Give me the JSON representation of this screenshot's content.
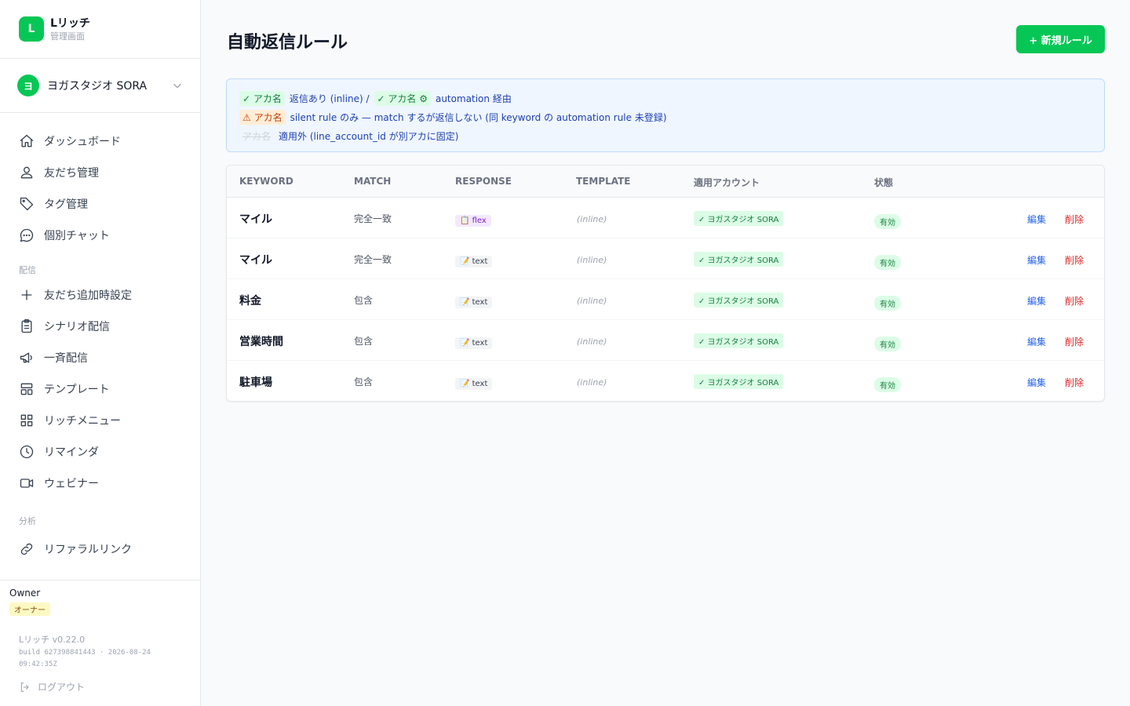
{
  "brand": {
    "logo_letter": "L",
    "name": "Lリッチ",
    "subtitle": "管理画面"
  },
  "account": {
    "avatar_letter": "ヨ",
    "name": "ヨガスタジオ SORA"
  },
  "nav": {
    "main": [
      {
        "label": "ダッシュボード",
        "icon": "home-icon"
      },
      {
        "label": "友だち管理",
        "icon": "users-icon"
      },
      {
        "label": "タグ管理",
        "icon": "tag-icon"
      },
      {
        "label": "個別チャット",
        "icon": "chat-icon"
      }
    ],
    "section_delivery": "配信",
    "delivery": [
      {
        "label": "友だち追加時設定",
        "icon": "plus-icon"
      },
      {
        "label": "シナリオ配信",
        "icon": "clipboard-icon"
      },
      {
        "label": "一斉配信",
        "icon": "megaphone-icon"
      },
      {
        "label": "テンプレート",
        "icon": "template-icon"
      },
      {
        "label": "リッチメニュー",
        "icon": "grid-icon"
      },
      {
        "label": "リマインダ",
        "icon": "clock-icon"
      },
      {
        "label": "ウェビナー",
        "icon": "video-icon"
      }
    ],
    "section_analytics": "分析",
    "analytics": [
      {
        "label": "リファラルリンク",
        "icon": "link-icon"
      }
    ]
  },
  "footer": {
    "owner_name": "Owner",
    "owner_badge": "オーナー",
    "version": "Lリッチ v0.22.0",
    "build": "build 627398841443 · 2026-08-24 09:42:35Z",
    "logout": "ログアウト"
  },
  "page": {
    "title": "自動返信ルール",
    "new_button": "+ 新規ルール"
  },
  "legend": {
    "line1": {
      "pill1": "✓ アカ名",
      "text1": "返信あり (inline) /",
      "pill2": "✓ アカ名 ⚙",
      "text2": "automation 経由"
    },
    "line2": {
      "pill": "⚠ アカ名",
      "text": "silent rule のみ — match するが返信しない (同 keyword の automation rule 未登録)"
    },
    "line3": {
      "pill": "アカ名",
      "text": "適用外 (line_account_id が別アカに固定)"
    }
  },
  "table": {
    "headers": {
      "keyword": "KEYWORD",
      "match": "MATCH",
      "response": "RESPONSE",
      "template": "TEMPLATE",
      "account": "適用アカウント",
      "status": "状態"
    },
    "rows": [
      {
        "keyword": "マイル",
        "match": "完全一致",
        "response": "📋 flex",
        "response_type": "flex",
        "template": "(inline)",
        "account": "✓ ヨガスタジオ SORA",
        "status": "有効",
        "edit": "編集",
        "delete": "削除"
      },
      {
        "keyword": "マイル",
        "match": "完全一致",
        "response": "📝 text",
        "response_type": "text",
        "template": "(inline)",
        "account": "✓ ヨガスタジオ SORA",
        "status": "有効",
        "edit": "編集",
        "delete": "削除"
      },
      {
        "keyword": "料金",
        "match": "包含",
        "response": "📝 text",
        "response_type": "text",
        "template": "(inline)",
        "account": "✓ ヨガスタジオ SORA",
        "status": "有効",
        "edit": "編集",
        "delete": "削除"
      },
      {
        "keyword": "営業時間",
        "match": "包含",
        "response": "📝 text",
        "response_type": "text",
        "template": "(inline)",
        "account": "✓ ヨガスタジオ SORA",
        "status": "有効",
        "edit": "編集",
        "delete": "削除"
      },
      {
        "keyword": "駐車場",
        "match": "包含",
        "response": "📝 text",
        "response_type": "text",
        "template": "(inline)",
        "account": "✓ ヨガスタジオ SORA",
        "status": "有効",
        "edit": "編集",
        "delete": "削除"
      }
    ]
  },
  "colors": {
    "brand": "#06c755",
    "link": "#2563eb",
    "danger": "#dc2626"
  }
}
